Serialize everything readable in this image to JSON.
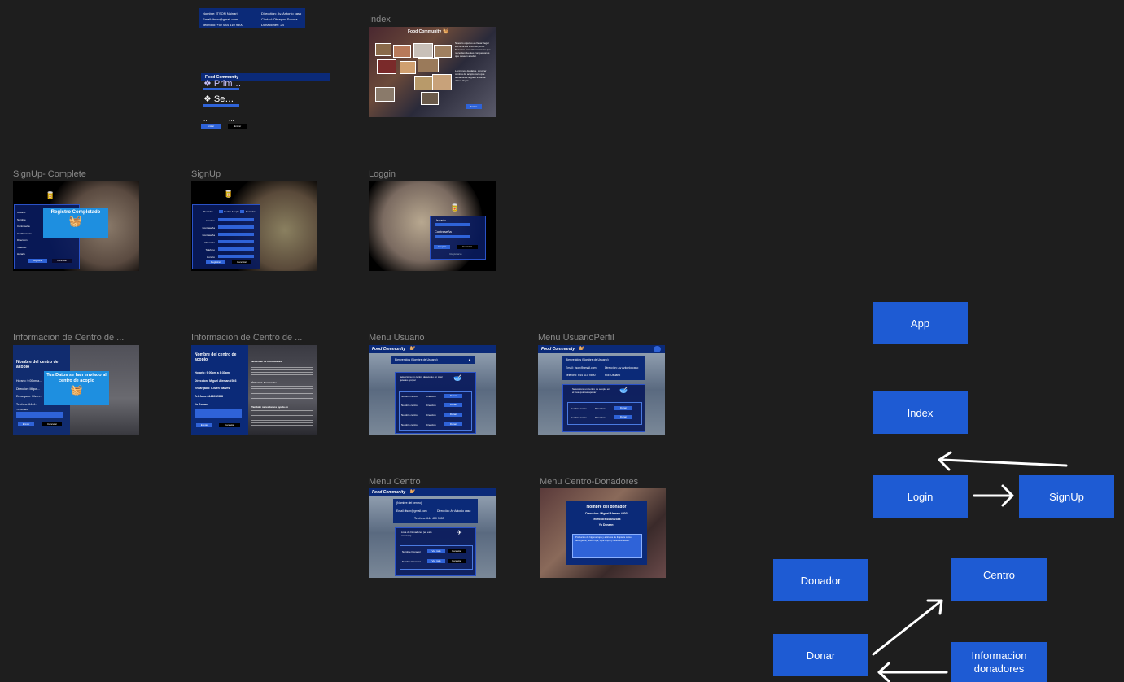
{
  "mini_card": {
    "col1": [
      "Nombre: ITSON Nainari",
      "Email: itson@gmail.com",
      "Telefono: +52 644 410 9800"
    ],
    "col2": [
      "Direcction: Av. Antonio caso",
      "Ciudad: Obregon Sonora",
      "Donaciones: 24"
    ]
  },
  "header_component": {
    "brand": "Food Community",
    "item1": "❖ Prim…",
    "item2": "❖ Se…",
    "dots": "...",
    "btn1": "Entrar",
    "btn2": "Entrar"
  },
  "frames": {
    "index": {
      "label": "Index",
      "brand": "Food Community",
      "text1": "Nuestro objetivo es llevar llegar los recursos a donde poner. Nosotros conectamos causa que necesiten fuentes con personas que deseen ayudar.",
      "text2": "Lanzamos de datos, conocer centros de acopio para que donaciones lleguen a donde deben llegar.",
      "button": "Entrar"
    },
    "signup_complete": {
      "label": "SignUp- Complete",
      "banner": "Registro Completado",
      "fields": [
        "Usuario",
        "Nombre",
        "Contraseña",
        "Confirmación",
        "Dirección",
        "Teléfono",
        "Horario"
      ],
      "btn1": "Registrar",
      "btn2": "Cancelar"
    },
    "signup": {
      "label": "SignUp",
      "radio1": "Donador",
      "radio2": "Centro Acopio",
      "radio3": "Donador",
      "fields": [
        "Nombre",
        "Contraseña",
        "Contraseña",
        "Dirección",
        "Telefono",
        "Horario"
      ],
      "btn1": "Registrar",
      "btn2": "Cancelar"
    },
    "loggin": {
      "label": "Loggin",
      "user_label": "Usuario",
      "pass_label": "Contraseña",
      "btn1": "Aceptar",
      "btn2": "Cancelar",
      "link": "Registrarse"
    },
    "info_centro_1": {
      "label": "Informacion de Centro de ...",
      "title": "Nombre del centro de acopio",
      "rows": [
        "Horario: 9:00pm a...",
        "Direccion: Migue...",
        "Encargado: Kilven...",
        "Telefono: 6444..."
      ],
      "donar": "Yo Donare",
      "banner": "Tus Datos se han enviado al centro de acopio",
      "btn1": "Enviar",
      "btn2": "Cancelar"
    },
    "info_centro_2": {
      "label": "Informacion de Centro de ...",
      "title": "Nombre del centro de acopio",
      "rows": [
        "Horario: 9:00pm a 8:30pm",
        "Direccion: Miguel Aleman #303",
        "Encargado: Kilven Galves",
        "Telefono:6444032388"
      ],
      "donar": "Yo Donare",
      "section1": "Necesitan se necesidades",
      "section2": "Útiles/Art. Personales",
      "section3": "También necesitamos ayuda en",
      "btn1": "Enviar",
      "btn2": "Cancelar"
    },
    "menu_usuario": {
      "label": "Menu Usuario",
      "brand": "Food Community",
      "welcome": "Bienvenidos (Nombre de Usuario)",
      "prompt": "Selecciona un centro de acopio en cual quieras apoyar",
      "rows": [
        "Nombre centro",
        "Nombre centro",
        "Nombre centro",
        "Nombre centro"
      ],
      "col": "Dirección",
      "btn": "Donar"
    },
    "menu_usuario_perfil": {
      "label": "Menu UsuarioPerfil",
      "brand": "Food Community",
      "welcome": "Bienvenidos (Nombre de Usuario)",
      "email": "Email: itson@gmail.com",
      "dir": "Dirección: Av Antonio caso",
      "tel": "Telefono: 644 410 9800",
      "rol": "Rol: Usuario",
      "prompt": "Selecciona un centro de acopio en el cual quieras apoyar",
      "rows": [
        "Nombre centro",
        "Nombre centro"
      ],
      "col": "Dirección",
      "btn": "Donar"
    },
    "menu_centro": {
      "label": "Menu Centro",
      "brand": "Food Community",
      "name": "(Nombre del centro)",
      "email": "Email: itson@gmail.com",
      "dir": "Dirección: Av Antonio caso",
      "tel": "Telefono: 644 410 9800",
      "list_title": "Lista de Donadores (en este mensaje)",
      "rows": [
        "Nombre Donador",
        "Nombre Donador"
      ],
      "btn1": "Ver más",
      "btn2": "Cancelar"
    },
    "menu_centro_donadores": {
      "label": "Menu Centro-Donadores",
      "title": "Nombre del donador",
      "dir": "Direccion: Miguel Aleman #303",
      "tel": "Telefono:6444032388",
      "donare": "Yo Donare:",
      "desc": "Productos de higiene/ropa y artículos de limpieza como detergente, jabón ropa, ropa limpia y útiles escolares."
    }
  },
  "flow": {
    "app": "App",
    "index": "Index",
    "login": "Login",
    "signup": "SignUp",
    "donador": "Donador",
    "centro": "Centro",
    "donar": "Donar",
    "info_donadores": "Informacion donadores"
  },
  "colors": {
    "canvas": "#1e1e1e",
    "node": "#1e5bd3",
    "navy": "#0b2a78",
    "accent_blue": "#2f63d8"
  }
}
